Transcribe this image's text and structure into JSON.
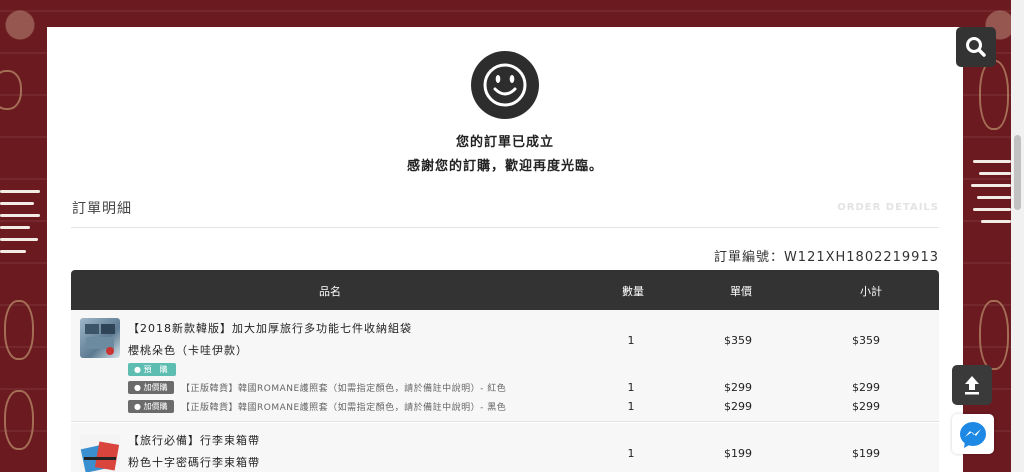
{
  "success": {
    "title": "您的訂單已成立",
    "subtitle": "感謝您的訂購，歡迎再度光臨。"
  },
  "section": {
    "title": "訂單明細",
    "title_en": "ORDER DETAILS"
  },
  "order_number": "訂單編號：W121XH1802219913",
  "table": {
    "headers": [
      "品名",
      "數量",
      "單價",
      "小計"
    ],
    "rows": [
      {
        "name": "【2018新款韓版】加大加厚旅行多功能七件收納組袋",
        "variant": "櫻桃朵色（卡哇伊款）",
        "qty": "1",
        "price": "$359",
        "subtotal": "$359",
        "tag": "預　購",
        "addons": [
          {
            "tag": "加價購",
            "text": "【正版韓貨】韓國ROMANE護照套（如需指定顏色，請於備註中說明）- 紅色",
            "qty": "1",
            "price": "$299",
            "subtotal": "$299"
          },
          {
            "tag": "加價購",
            "text": "【正版韓貨】韓國ROMANE護照套（如需指定顏色，請於備註中說明）- 黑色",
            "qty": "1",
            "price": "$299",
            "subtotal": "$299"
          }
        ]
      },
      {
        "name": "【旅行必備】行李束箱帶",
        "variant": "粉色十字密碼行李束箱帶",
        "qty": "1",
        "price": "$199",
        "subtotal": "$199"
      }
    ]
  },
  "icons": {
    "search": "search-icon",
    "upload": "arrow-up-icon",
    "messenger": "messenger-icon",
    "smile": "smile-icon"
  },
  "colors": {
    "background": "#6b1a1f",
    "header": "#333333",
    "preorder_tag": "#5dbdb1",
    "addon_tag": "#6b6b6b"
  }
}
